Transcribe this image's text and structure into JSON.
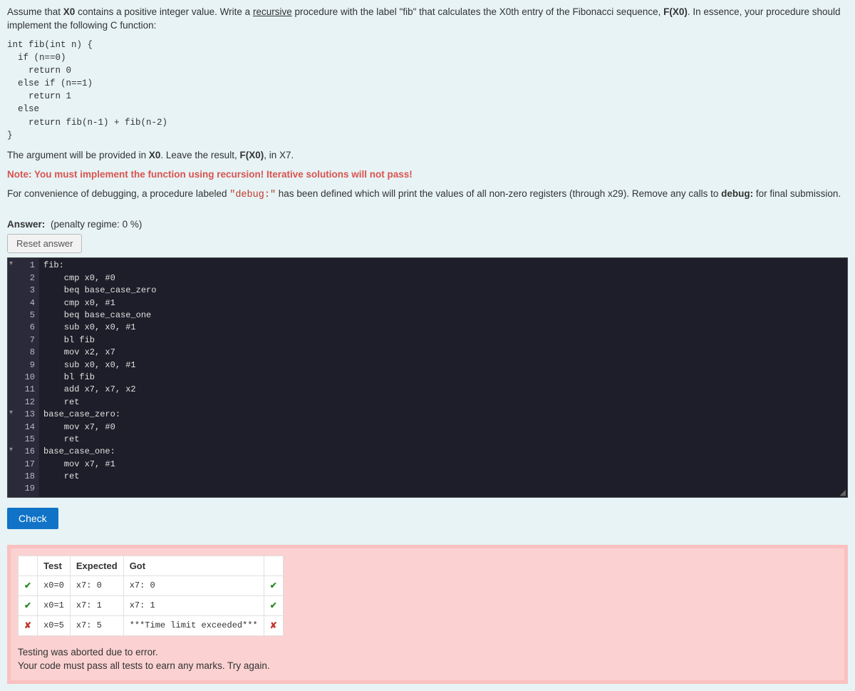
{
  "question": {
    "intro_prefix": "Assume that ",
    "x0": "X0",
    "intro_mid1": " contains a positive integer value. Write a ",
    "recursive": "recursive",
    "intro_mid2": " procedure with the label \"fib\" that calculates the X0th entry of the Fibonacci sequence, ",
    "fx0_a": "F(X0)",
    "intro_suffix": ". In essence, your procedure should implement the following C function:",
    "c_code": "int fib(int n) {\n  if (n==0)\n    return 0\n  else if (n==1)\n    return 1\n  else\n    return fib(n-1) + fib(n-2)\n}",
    "arg_line_prefix": "The argument will be provided in ",
    "arg_line_mid": ". Leave the result, ",
    "arg_line_suffix": ", in X7.",
    "note": "Note: You must implement the function using recursion! Iterative solutions will not pass!",
    "debug_prefix": "For convenience of debugging, a procedure labeled ",
    "debug_label": "\"debug:\"",
    "debug_mid": " has been defined which will print the values of all non-zero registers (through x29). Remove any calls to ",
    "debug_word": "debug:",
    "debug_suffix": " for final submission."
  },
  "answer": {
    "label": "Answer:",
    "penalty": "(penalty regime: 0 %)",
    "reset": "Reset answer"
  },
  "editor": {
    "lines": [
      {
        "n": "1",
        "fold": true,
        "html": "fib:"
      },
      {
        "n": "2",
        "fold": false,
        "html": "    cmp x0, #0"
      },
      {
        "n": "3",
        "fold": false,
        "html": "    beq base_case_zero"
      },
      {
        "n": "4",
        "fold": false,
        "html": "    cmp x0, #1"
      },
      {
        "n": "5",
        "fold": false,
        "html": "    beq base_case_one"
      },
      {
        "n": "6",
        "fold": false,
        "html": "    sub x0, x0, #1"
      },
      {
        "n": "7",
        "fold": false,
        "html": "    bl fib"
      },
      {
        "n": "8",
        "fold": false,
        "html": "    mov x2, x7"
      },
      {
        "n": "9",
        "fold": false,
        "html": "    sub x0, x0, #1"
      },
      {
        "n": "10",
        "fold": false,
        "html": "    bl fib"
      },
      {
        "n": "11",
        "fold": false,
        "html": "    add x7, x7, x2"
      },
      {
        "n": "12",
        "fold": false,
        "html": "    ret"
      },
      {
        "n": "13",
        "fold": true,
        "html": "base_case_zero:"
      },
      {
        "n": "14",
        "fold": false,
        "html": "    mov x7, #0"
      },
      {
        "n": "15",
        "fold": false,
        "html": "    ret"
      },
      {
        "n": "16",
        "fold": true,
        "html": "base_case_one:"
      },
      {
        "n": "17",
        "fold": false,
        "html": "    mov x7, #1"
      },
      {
        "n": "18",
        "fold": false,
        "html": "    ret"
      },
      {
        "n": "19",
        "fold": false,
        "html": ""
      }
    ]
  },
  "check_label": "Check",
  "results": {
    "headers": {
      "status": "",
      "test": "Test",
      "expected": "Expected",
      "got": "Got",
      "status2": ""
    },
    "rows": [
      {
        "pass": true,
        "test": "x0=0",
        "expected": "x7: 0",
        "got": "x7: 0"
      },
      {
        "pass": true,
        "test": "x0=1",
        "expected": "x7: 1",
        "got": "x7: 1"
      },
      {
        "pass": false,
        "test": "x0=5",
        "expected": "x7: 5",
        "got": "***Time limit exceeded***"
      }
    ],
    "msg1": "Testing was aborted due to error.",
    "msg2": "Your code must pass all tests to earn any marks. Try again."
  }
}
